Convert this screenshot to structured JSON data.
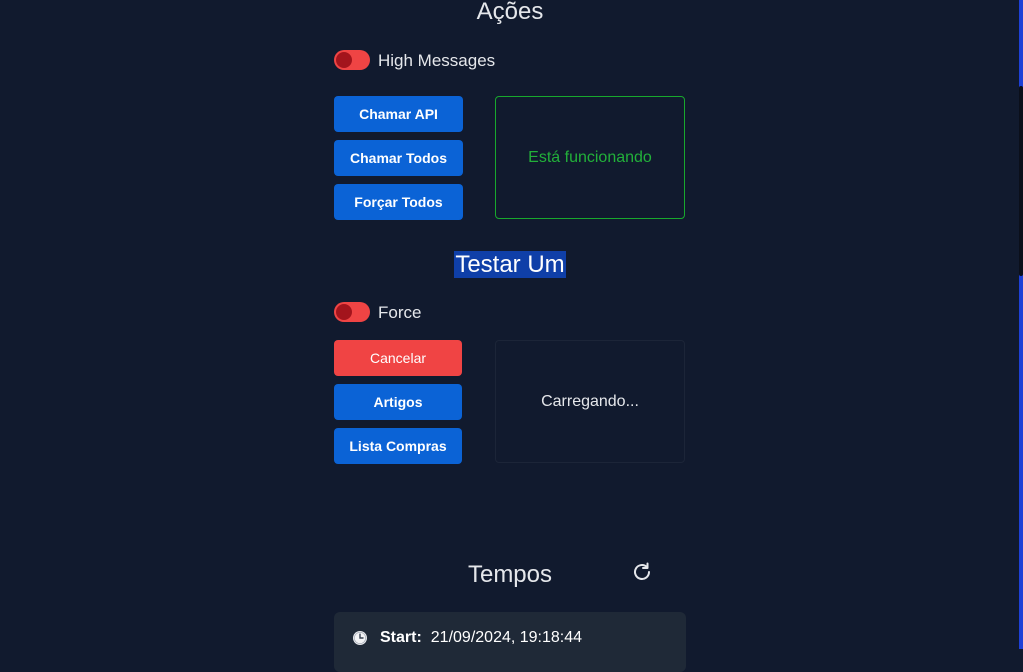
{
  "acoes": {
    "title": "Ações",
    "toggle_label": "High Messages",
    "buttons": [
      "Chamar API",
      "Chamar Todos",
      "Forçar Todos"
    ],
    "status": "Está funcionando",
    "status_color": "#22b03a"
  },
  "testar": {
    "title": "Testar Um",
    "toggle_label": "Force",
    "buttons": [
      "Cancelar",
      "Artigos",
      "Lista Compras"
    ],
    "status": "Carregando..."
  },
  "tempos": {
    "title": "Tempos",
    "refresh_icon": "refresh-icon",
    "rows": [
      {
        "icon": "clock-icon",
        "key": "Start:",
        "value": "21/09/2024, 19:18:44"
      }
    ]
  },
  "colors": {
    "background": "#111a2e",
    "primary": "#0b63d6",
    "danger": "#f04444",
    "toggle_on": "#ef4444"
  }
}
